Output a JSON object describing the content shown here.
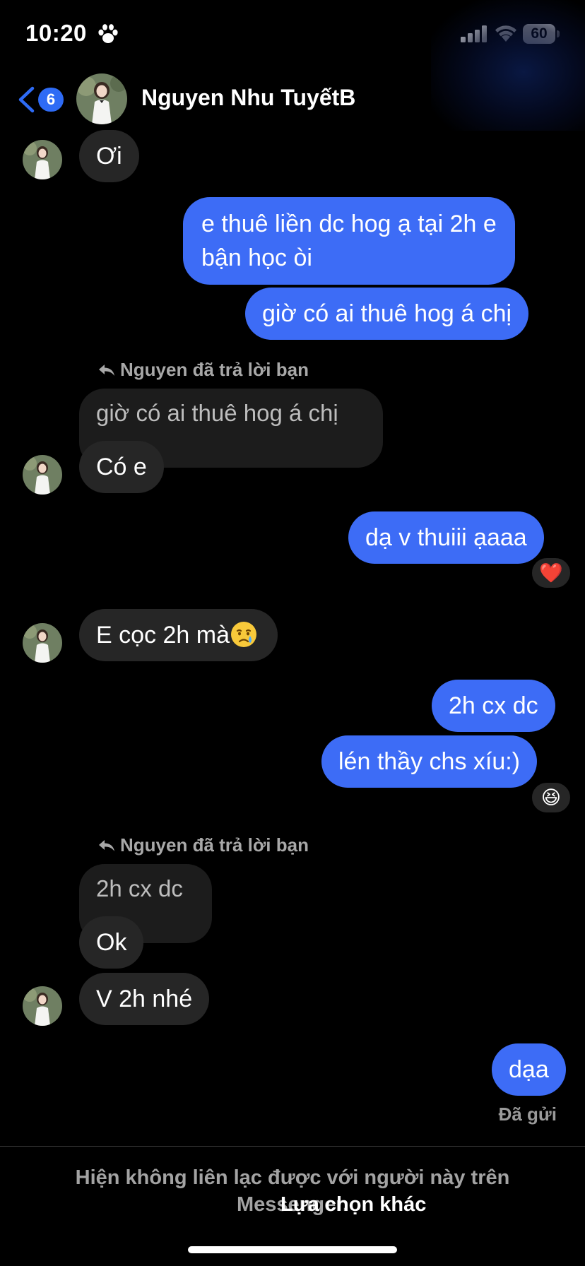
{
  "status_bar": {
    "time": "10:20",
    "battery": "60",
    "icons": [
      "paw-icon",
      "signal-icon",
      "wifi-icon",
      "battery-icon"
    ]
  },
  "header": {
    "back_count": "6",
    "name": "Nguyen Nhu TuyếtB",
    "accent_color": "#2e6bf5"
  },
  "messages": {
    "m1": "Ơi",
    "m2_line1": "e thuê liền dc hog ạ tại 2h e",
    "m2_line2": "bận học òi",
    "m3": "giờ có ai thuê hog á chị",
    "reply1_label": "Nguyen đã trả lời bạn",
    "reply1_quote": "giờ có ai thuê hog á chị",
    "m4": "Có e",
    "m5": "dạ v thuiii ạaaa",
    "m5_reaction": "❤️",
    "m6": "E cọc 2h mà",
    "m6_emoji": "crying-face-icon",
    "m7": "2h cx dc",
    "m8": "lén thầy chs xíu:)",
    "m8_reaction": "😆",
    "reply2_label": "Nguyen đã trả lời bạn",
    "reply2_quote": "2h cx dc",
    "m9": "Ok",
    "m10": "V 2h nhé",
    "m11": "dạa",
    "sent_status": "Đã gửi"
  },
  "notice": {
    "text": "Hiện không liên lạc được với người này trên Messenger.",
    "link": "Lựa chọn khác"
  },
  "colors": {
    "outgoing_bubble": "#3d6cf6",
    "incoming_bubble": "#262626",
    "background": "#000000"
  }
}
